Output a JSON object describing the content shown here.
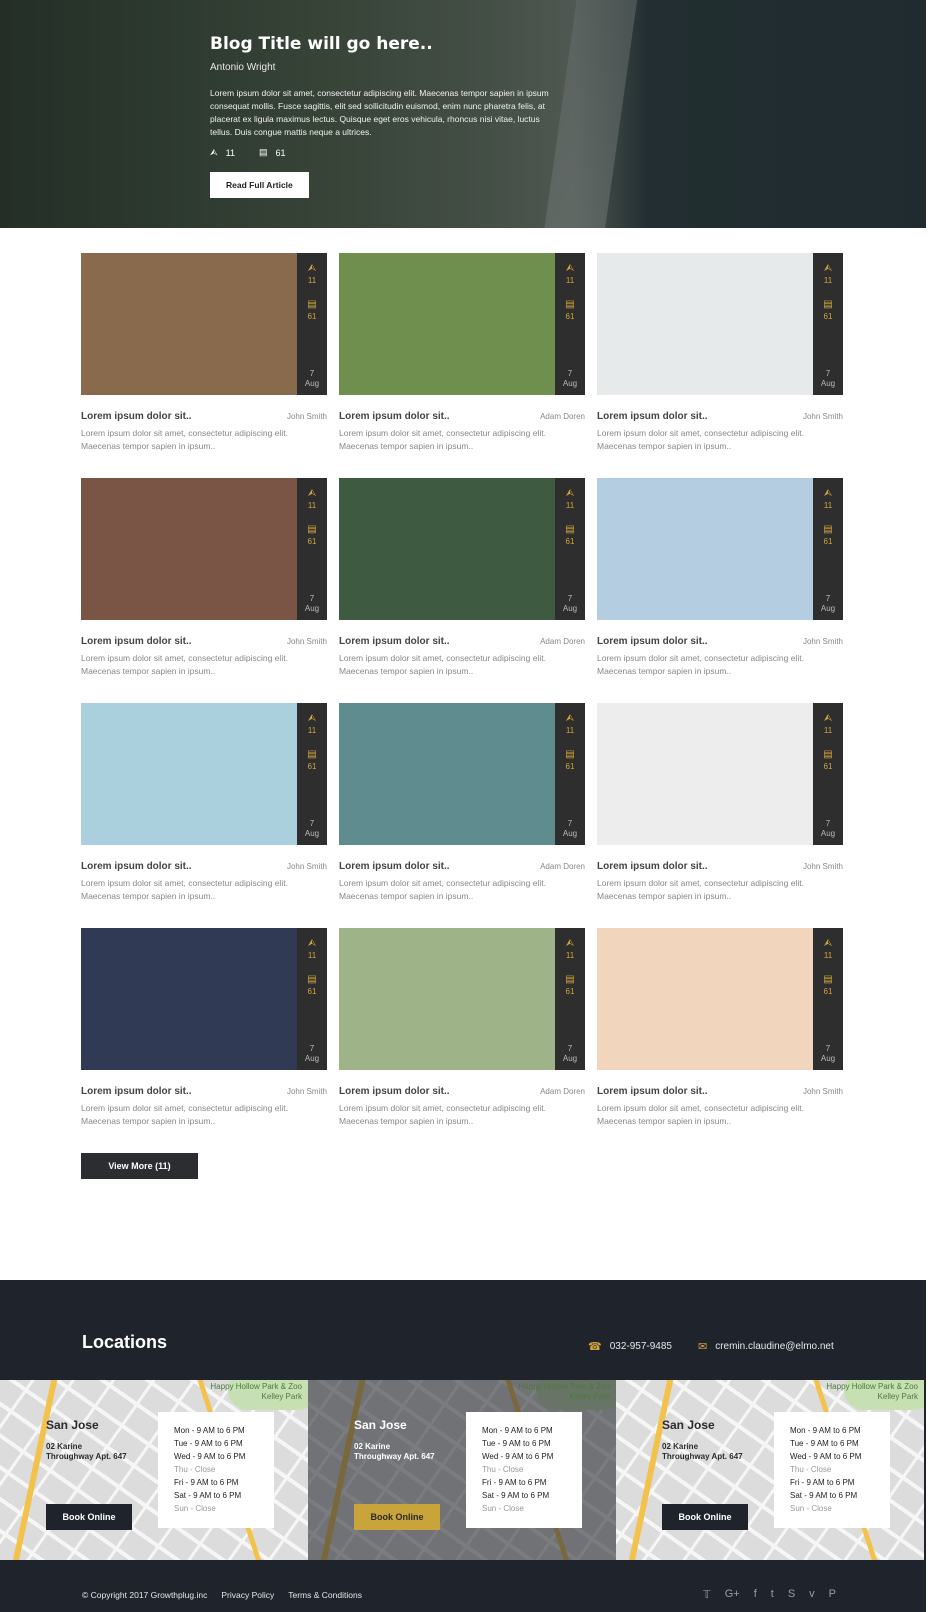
{
  "hero": {
    "title": "Blog Title will go here..",
    "author": "Antonio Wright",
    "excerpt": "Lorem ipsum dolor sit amet, consectetur adipiscing elit. Maecenas tempor sapien in ipsum consequat mollis. Fusce sagittis, elit sed sollicitudin euismod, enim nunc pharetra felis, at placerat ex ligula maximus lectus. Quisque eget eros vehicula, rhoncus nisi vitae, luctus tellus. Duis congue mattis neque a ultrices.",
    "shares": "11",
    "comments": "61",
    "button": "Read Full Article"
  },
  "posts": [
    {
      "title": "Lorem ipsum dolor sit..",
      "author": "John Smith",
      "excerpt": "Lorem ipsum dolor sit amet, consectetur adipiscing elit. Maecenas tempor sapien in ipsum..",
      "shares": "11",
      "comments": "61",
      "day": "7",
      "month": "Aug",
      "color": "#8a6a4c"
    },
    {
      "title": "Lorem ipsum dolor sit..",
      "author": "Adam Doren",
      "excerpt": "Lorem ipsum dolor sit amet, consectetur adipiscing elit. Maecenas tempor sapien in ipsum..",
      "shares": "11",
      "comments": "61",
      "day": "7",
      "month": "Aug",
      "color": "#6f8f4e"
    },
    {
      "title": "Lorem ipsum dolor sit..",
      "author": "John Smith",
      "excerpt": "Lorem ipsum dolor sit amet, consectetur adipiscing elit. Maecenas tempor sapien in ipsum..",
      "shares": "11",
      "comments": "61",
      "day": "7",
      "month": "Aug",
      "color": "#e6eaea"
    },
    {
      "title": "Lorem ipsum dolor sit..",
      "author": "John Smith",
      "excerpt": "Lorem ipsum dolor sit amet, consectetur adipiscing elit. Maecenas tempor sapien in ipsum..",
      "shares": "11",
      "comments": "61",
      "day": "7",
      "month": "Aug",
      "color": "#7a5546"
    },
    {
      "title": "Lorem ipsum dolor sit..",
      "author": "Adam Doren",
      "excerpt": "Lorem ipsum dolor sit amet, consectetur adipiscing elit. Maecenas tempor sapien in ipsum..",
      "shares": "11",
      "comments": "61",
      "day": "7",
      "month": "Aug",
      "color": "#3e5a40"
    },
    {
      "title": "Lorem ipsum dolor sit..",
      "author": "John Smith",
      "excerpt": "Lorem ipsum dolor sit amet, consectetur adipiscing elit. Maecenas tempor sapien in ipsum..",
      "shares": "11",
      "comments": "61",
      "day": "7",
      "month": "Aug",
      "color": "#b4cde0"
    },
    {
      "title": "Lorem ipsum dolor sit..",
      "author": "John Smith",
      "excerpt": "Lorem ipsum dolor sit amet, consectetur adipiscing elit. Maecenas tempor sapien in ipsum..",
      "shares": "11",
      "comments": "61",
      "day": "7",
      "month": "Aug",
      "color": "#a9d0dc"
    },
    {
      "title": "Lorem ipsum dolor sit..",
      "author": "Adam Doren",
      "excerpt": "Lorem ipsum dolor sit amet, consectetur adipiscing elit. Maecenas tempor sapien in ipsum..",
      "shares": "11",
      "comments": "61",
      "day": "7",
      "month": "Aug",
      "color": "#5f8c8e"
    },
    {
      "title": "Lorem ipsum dolor sit..",
      "author": "John Smith",
      "excerpt": "Lorem ipsum dolor sit amet, consectetur adipiscing elit. Maecenas tempor sapien in ipsum..",
      "shares": "11",
      "comments": "61",
      "day": "7",
      "month": "Aug",
      "color": "#ededed"
    },
    {
      "title": "Lorem ipsum dolor sit..",
      "author": "John Smith",
      "excerpt": "Lorem ipsum dolor sit amet, consectetur adipiscing elit. Maecenas tempor sapien in ipsum..",
      "shares": "11",
      "comments": "61",
      "day": "7",
      "month": "Aug",
      "color": "#313a54"
    },
    {
      "title": "Lorem ipsum dolor sit..",
      "author": "Adam Doren",
      "excerpt": "Lorem ipsum dolor sit amet, consectetur adipiscing elit. Maecenas tempor sapien in ipsum..",
      "shares": "11",
      "comments": "61",
      "day": "7",
      "month": "Aug",
      "color": "#9fb389"
    },
    {
      "title": "Lorem ipsum dolor sit..",
      "author": "John Smith",
      "excerpt": "Lorem ipsum dolor sit amet, consectetur adipiscing elit. Maecenas tempor sapien in ipsum..",
      "shares": "11",
      "comments": "61",
      "day": "7",
      "month": "Aug",
      "color": "#f1d6bd"
    }
  ],
  "view_more": "View More (11)",
  "locations": {
    "title": "Locations",
    "phone": "032-957-9485",
    "email": "cremin.claudine@elmo.net",
    "park_label": "Happy Hollow Park & Zoo",
    "park_label2": "Kelley Park",
    "items": [
      {
        "city": "San Jose",
        "line1": "02 Karine",
        "line2": "Throughway Apt. 647",
        "button": "Book Online",
        "hours": [
          "Mon - 9 AM to 6 PM",
          "Tue - 9 AM to 6 PM",
          "Wed - 9 AM to 6 PM",
          "Thu - Close",
          "Fri - 9 AM to 6 PM",
          "Sat - 9 AM to 6 PM",
          "Sun - Close"
        ]
      },
      {
        "city": "San Jose",
        "line1": "02 Karine",
        "line2": "Throughway Apt. 647",
        "button": "Book Online",
        "hours": [
          "Mon - 9 AM to 6 PM",
          "Tue - 9 AM to 6 PM",
          "Wed - 9 AM to 6 PM",
          "Thu - Close",
          "Fri - 9 AM to 6 PM",
          "Sat - 9 AM to 6 PM",
          "Sun - Close"
        ]
      },
      {
        "city": "San Jose",
        "line1": "02 Karine",
        "line2": "Throughway Apt. 647",
        "button": "Book Online",
        "hours": [
          "Mon - 9 AM to 6 PM",
          "Tue - 9 AM to 6 PM",
          "Wed - 9 AM to 6 PM",
          "Thu - Close",
          "Fri - 9 AM to 6 PM",
          "Sat - 9 AM to 6 PM",
          "Sun - Close"
        ]
      }
    ]
  },
  "footer": {
    "copyright": "© Copyright 2017 Growthplug.inc",
    "privacy": "Privacy Policy",
    "terms": "Terms & Conditions",
    "socials": [
      "twitter-icon",
      "google-plus-icon",
      "facebook-icon",
      "tumblr-icon",
      "skype-icon",
      "vimeo-icon",
      "pinterest-icon"
    ]
  },
  "colors": {
    "accent": "#d4a63a",
    "footer_bg": "#1f242c",
    "dark": "#2e2e2e"
  }
}
